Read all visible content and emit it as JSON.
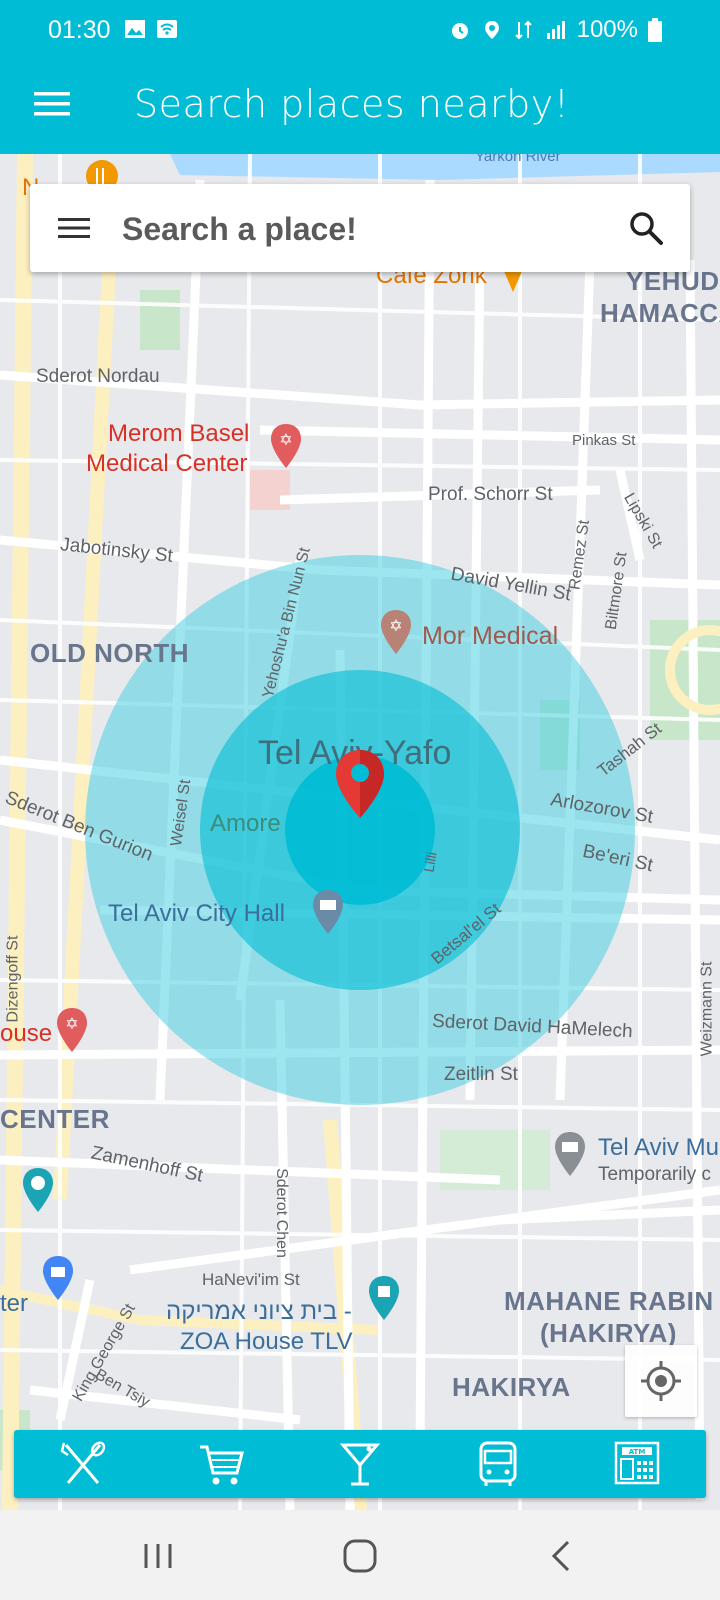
{
  "status_bar": {
    "time": "01:30",
    "battery": "100%"
  },
  "app_bar": {
    "title": "Search places nearby!"
  },
  "search": {
    "placeholder": "Search a place!"
  },
  "map": {
    "streets": {
      "yarkon_river": "Yarkon River",
      "sderot_nordau": "Sderot Nordau",
      "pinkas": "Pinkas St",
      "prof_schorr": "Prof. Schorr St",
      "jabotinsky": "Jabotinsky St",
      "yehoshua_bin_nun": "Yehoshu'a Bin Nun St",
      "david_yellin": "David Yellin St",
      "remez": "Remez St",
      "biltmore": "Biltmore St",
      "lipski": "Lipski St",
      "tashah": "Tashah St",
      "weisel": "Weisel St",
      "arlozorov": "Arlozorov St",
      "beeri": "Be'eri St",
      "sderot_ben_gurion": "Sderot Ben Gurion",
      "betsalel": "Betsal'el St",
      "lilli": "Lilli",
      "sderot_david_hamelech": "Sderot David HaMelech",
      "zeitlin": "Zeitlin St",
      "weizmann": "Weizmann St",
      "dizengoff": "Dizengoff St",
      "zamenhoff": "Zamenhoff St",
      "sderot_chen": "Sderot Chen",
      "hanevim": "HaNevi'im St",
      "king_george": "King George St",
      "ben_tsiyon": "Ben Tsiy"
    },
    "districts": {
      "yehuda": "YEHUDA",
      "hamacca": "HAMACCA",
      "old_north": "OLD NORTH",
      "center": "CENTER",
      "mahane_rabin": "MAHANE RABIN",
      "hakirya_paren": "(HAKIRYA)",
      "hakirya": "HAKIRYA"
    },
    "places": {
      "cafe_zorik": "Cafe Zorik",
      "merom_basel_1": "Merom Basel",
      "merom_basel_2": "Medical Center",
      "mor_medical": "Mor Medical",
      "tel_aviv_yafo": "Tel Aviv-Yafo",
      "amore": "Amore",
      "city_hall": "Tel Aviv City Hall",
      "ouse": "ouse",
      "museum_1": "Tel Aviv Mu",
      "museum_2": "Temporarily c",
      "zoa_1": "בית ציוני אמריקה -",
      "zoa_2": "ZOA House TLV",
      "ter": "ter",
      "n_top": "N"
    }
  },
  "categories": [
    {
      "name": "restaurants",
      "icon": "fork-knife-icon"
    },
    {
      "name": "shopping",
      "icon": "cart-icon"
    },
    {
      "name": "bars",
      "icon": "cocktail-icon"
    },
    {
      "name": "transit",
      "icon": "bus-icon"
    },
    {
      "name": "atm",
      "icon": "atm-icon"
    }
  ],
  "colors": {
    "primary": "#00bcd4",
    "marker": "#e53935",
    "radius_outer": "#4dd0e1",
    "radius_inner": "#00bcd4"
  }
}
